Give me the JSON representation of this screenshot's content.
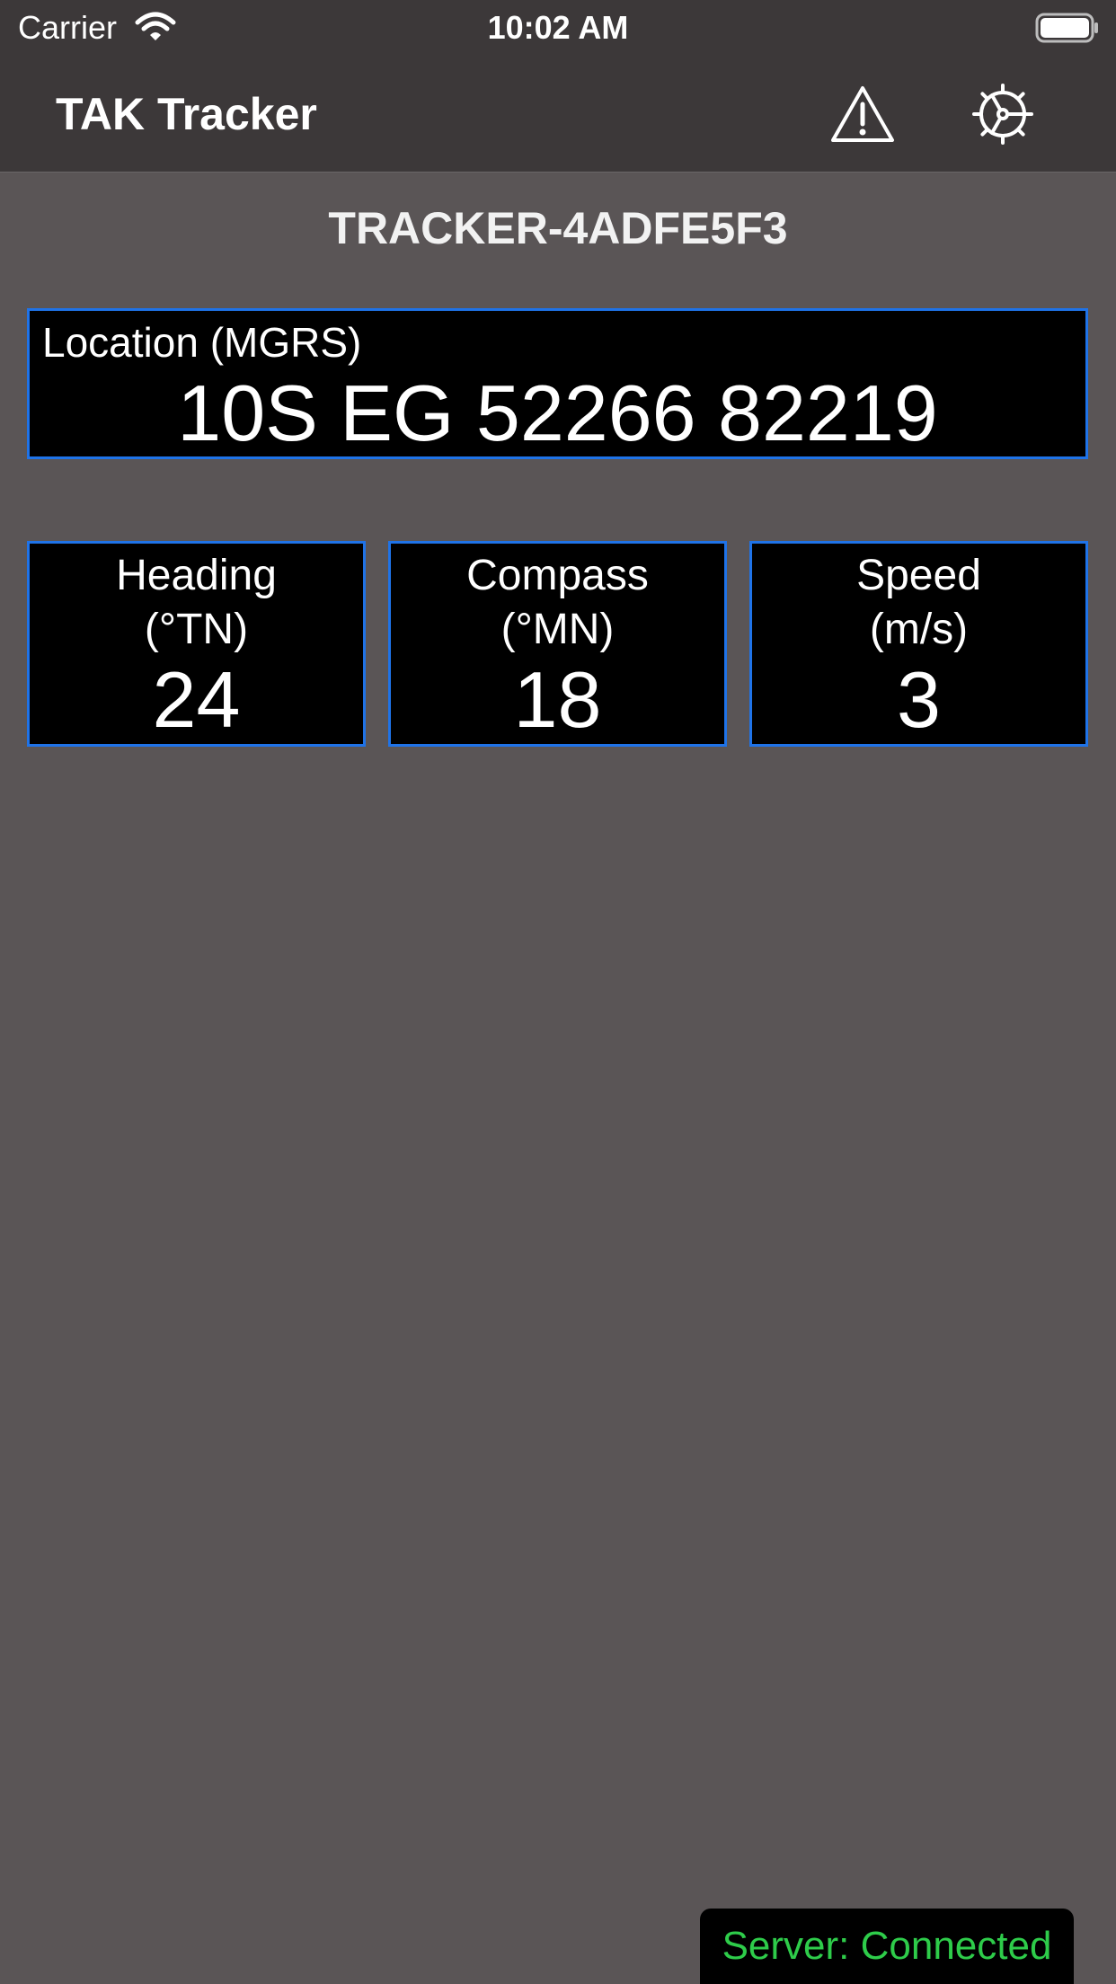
{
  "status_bar": {
    "carrier": "Carrier",
    "time": "10:02 AM"
  },
  "nav": {
    "title": "TAK Tracker",
    "warning_icon": "warning-triangle-icon",
    "settings_icon": "gear-icon"
  },
  "device": {
    "id": "TRACKER-4ADFE5F3"
  },
  "location": {
    "label": "Location (MGRS)",
    "value": "10S EG 52266 82219"
  },
  "metrics": [
    {
      "label": "Heading",
      "unit": "(°TN)",
      "value": "24"
    },
    {
      "label": "Compass",
      "unit": "(°MN)",
      "value": "18"
    },
    {
      "label": "Speed",
      "unit": "(m/s)",
      "value": "3"
    }
  ],
  "server": {
    "status": "Server: Connected"
  },
  "colors": {
    "background": "#5a5556",
    "bar": "#3c3839",
    "panel_border": "#1f73e8",
    "panel_fill": "#000000",
    "connected_text": "#2ecc4a"
  }
}
